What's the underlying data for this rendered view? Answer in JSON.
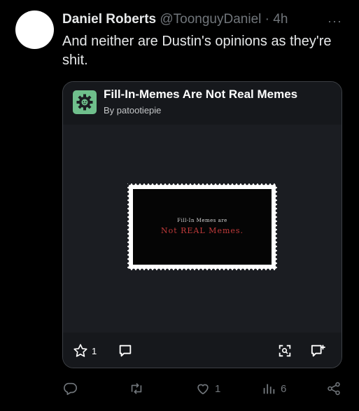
{
  "tweet": {
    "author_name": "Daniel Roberts",
    "handle": "@ToonguyDaniel",
    "separator": "·",
    "time": "4h",
    "more_icon": "ellipsis-icon",
    "text": "And neither are Dustin's opinions as they're shit."
  },
  "card": {
    "title": "Fill-In-Memes Are Not Real Memes",
    "byline": "By patootiepie",
    "image": {
      "line1": "Fill-In Memes are",
      "line2": "Not REAL Memes."
    },
    "footer": {
      "star_count": "1",
      "icons": [
        "star-icon",
        "comment-icon",
        "scan-icon",
        "add-comment-icon"
      ]
    }
  },
  "actions": {
    "reply_count": "",
    "retweet_count": "",
    "like_count": "1",
    "views_count": "6"
  },
  "colors": {
    "background": "#000000",
    "text": "#e7e9ea",
    "muted": "#71767b",
    "card_bg": "#16181c",
    "logo_green": "#6fbf8c",
    "stamp_red": "#c23b3b"
  }
}
